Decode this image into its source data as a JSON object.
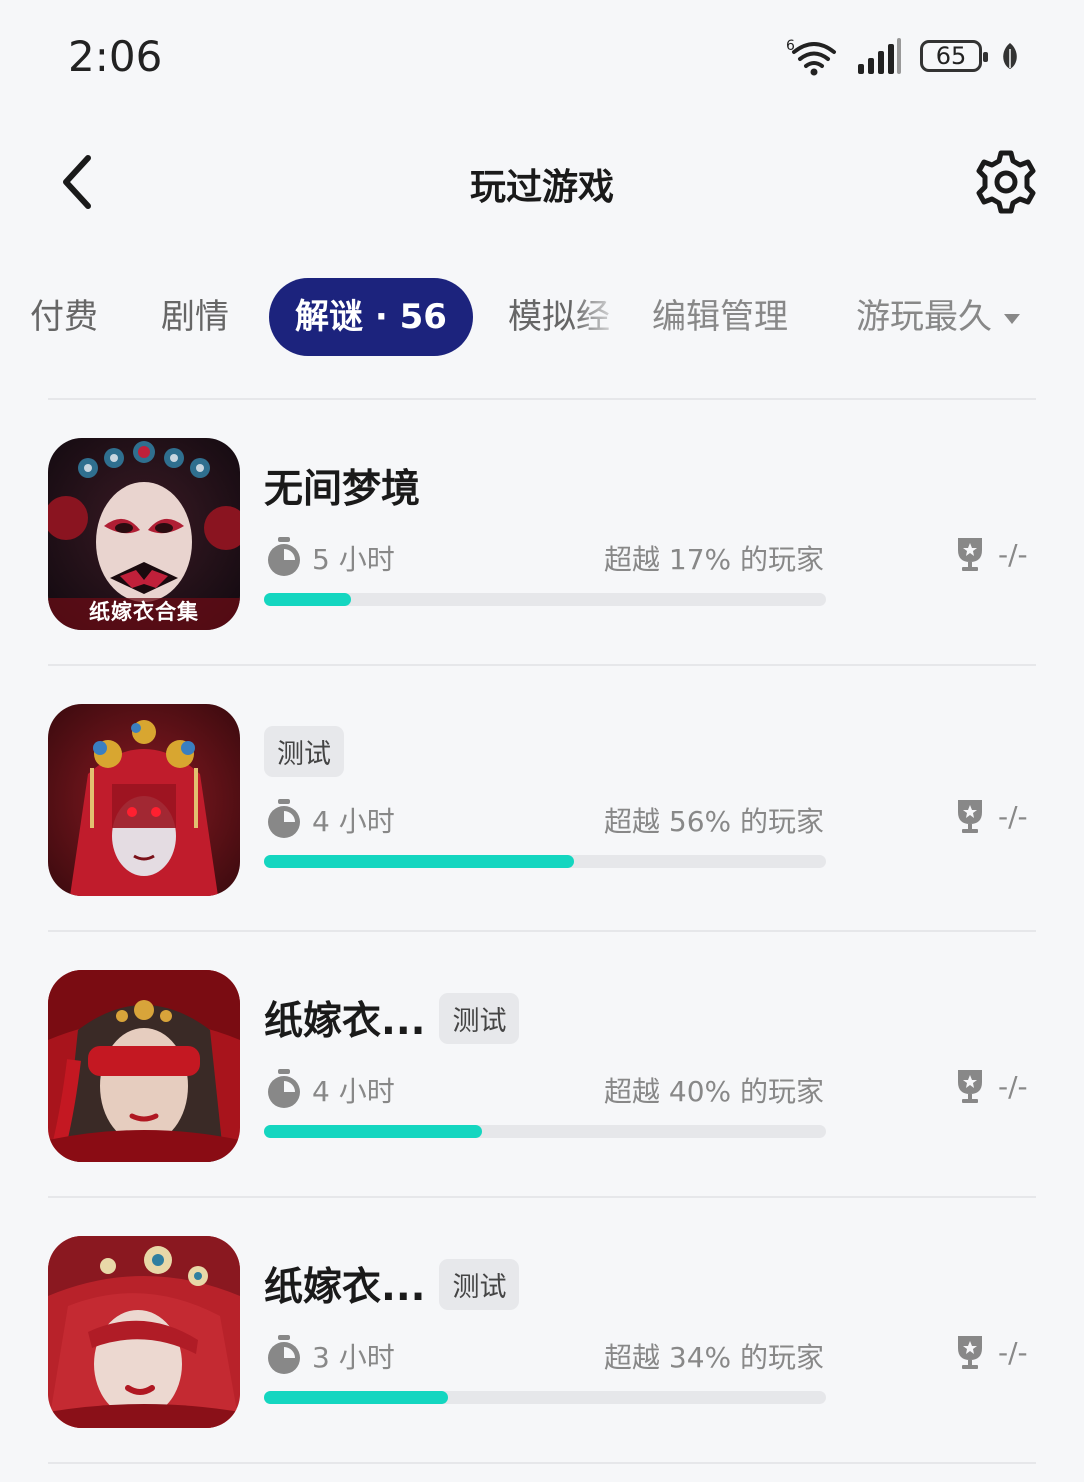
{
  "status_bar": {
    "time": "2:06",
    "battery": "65",
    "wifi_label": "6"
  },
  "header": {
    "title": "玩过游戏",
    "back_icon": "chevron-left-icon",
    "settings_icon": "gear-icon"
  },
  "tabs": [
    {
      "label": "付费"
    },
    {
      "label": "剧情"
    },
    {
      "label": "解谜 · 56",
      "active": true
    },
    {
      "label": "模拟经"
    },
    {
      "label": "编辑管理"
    },
    {
      "label": "游玩最久"
    }
  ],
  "colors": {
    "accent": "#1c237d",
    "progress": "#14d6c0",
    "track": "#e6e7ea",
    "background": "#f6f7f9"
  },
  "games": [
    {
      "title": "无间梦境",
      "badge": "",
      "thumb_caption": "纸嫁衣合集",
      "hours": "5 小时",
      "rank": "超越 17% 的玩家",
      "trophy": "-/-",
      "progress": 0.154
    },
    {
      "title": "",
      "badge": "测试",
      "thumb_caption": "",
      "hours": "4 小时",
      "rank": "超越 56% 的玩家",
      "trophy": "-/-",
      "progress": 0.552
    },
    {
      "title": "纸嫁衣...",
      "badge": "测试",
      "thumb_caption": "",
      "hours": "4 小时",
      "rank": "超越 40% 的玩家",
      "trophy": "-/-",
      "progress": 0.388
    },
    {
      "title": "纸嫁衣...",
      "badge": "测试",
      "thumb_caption": "",
      "hours": "3 小时",
      "rank": "超越 34% 的玩家",
      "trophy": "-/-",
      "progress": 0.327
    }
  ]
}
